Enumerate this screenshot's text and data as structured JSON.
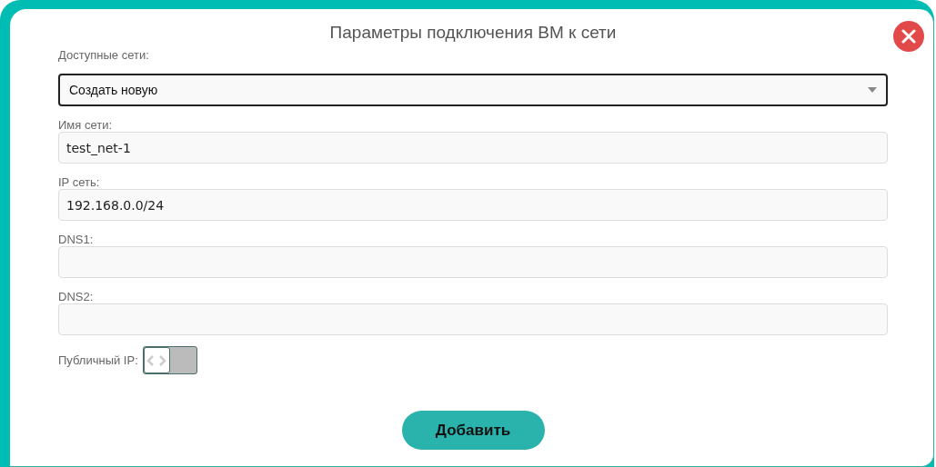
{
  "dialog": {
    "title": "Параметры подключения ВМ к сети"
  },
  "fields": [
    {
      "kind": "select",
      "label": "Доступные сети:",
      "value": "Создать новую",
      "focused": true
    },
    {
      "kind": "text",
      "label": "Имя сети:",
      "value": "test_net-1",
      "focused": false
    },
    {
      "kind": "text",
      "label": "IP сеть:",
      "value": "192.168.0.0/24",
      "focused": false
    },
    {
      "kind": "text",
      "label": "DNS1:",
      "focused": false
    },
    {
      "kind": "text",
      "label": "DNS2:",
      "focused": false
    }
  ],
  "public_ip": {
    "label": "Публичный IP:",
    "on": false
  },
  "submit_button": "Добавить"
}
